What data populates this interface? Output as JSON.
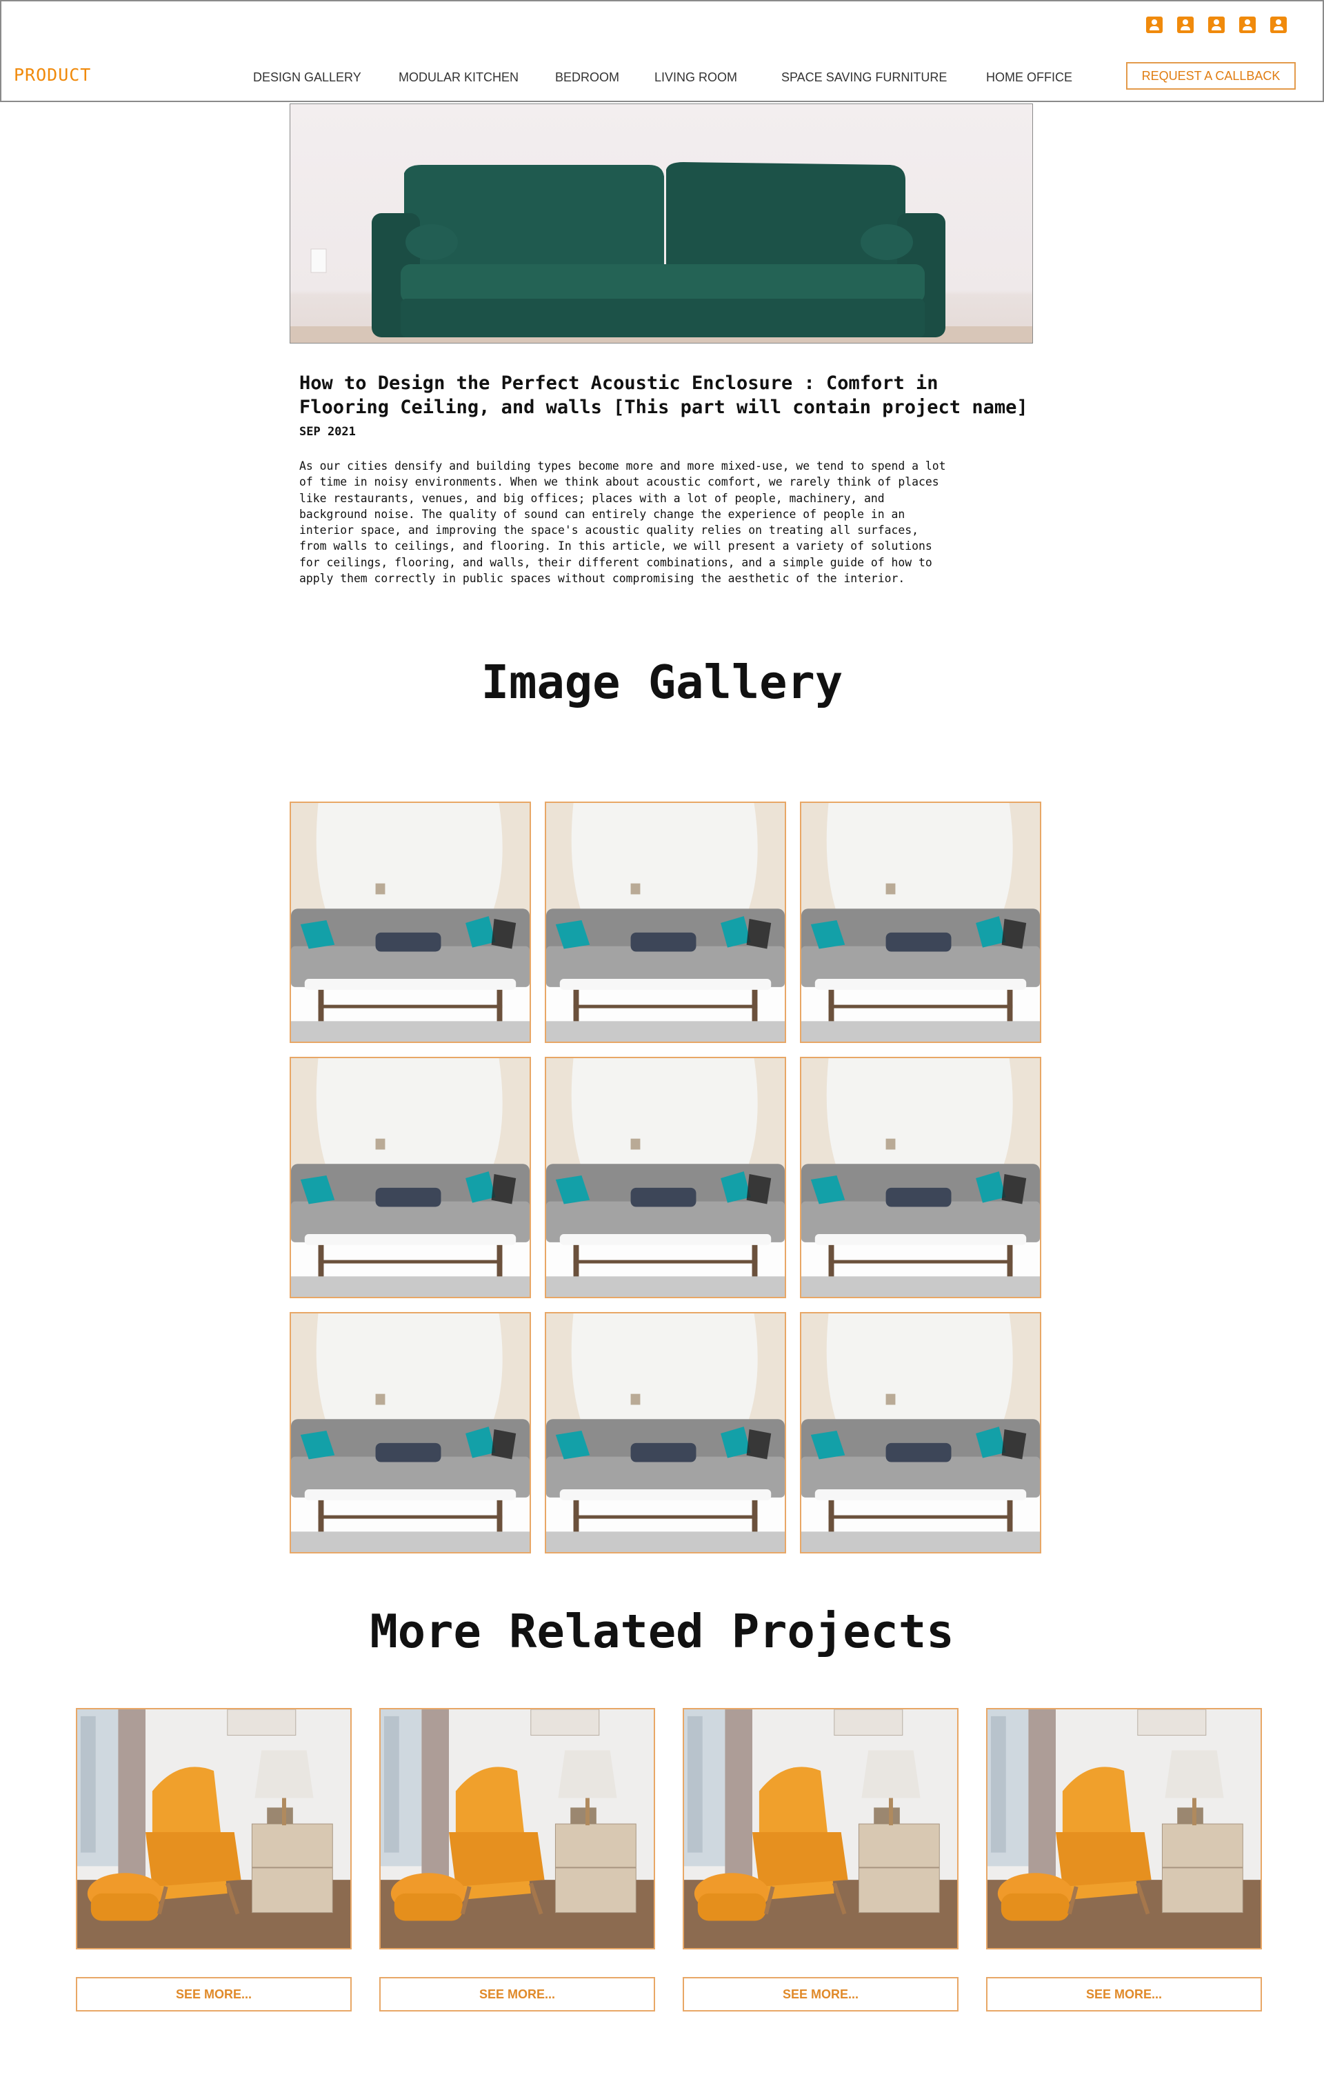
{
  "header": {
    "icons": [
      "user-icon",
      "user-icon",
      "user-icon",
      "user-icon",
      "user-icon"
    ],
    "accent_color": "#f08a0c"
  },
  "nav": {
    "brand": "PRODUCT",
    "links": [
      "DESIGN GALLERY",
      "MODULAR KITCHEN",
      "BEDROOM",
      "LIVING ROOM",
      "SPACE SAVING FURNITURE",
      "HOME OFFICE"
    ],
    "cta": "REQUEST A CALLBACK"
  },
  "article": {
    "hero_image": "green velvet sofa",
    "title": "How to Design the Perfect Acoustic Enclosure : Comfort in Flooring Ceiling, and walls [This part will contain project name]",
    "date": "SEP 2021",
    "body": "As our cities densify and building types become more and more mixed-use, we tend to spend a lot\nof time in noisy environments. When we think about acoustic comfort, we rarely think of places\nlike restaurants, venues, and big offices; places with a lot of people, machinery, and\nbackground noise. The quality of sound can entirely change the experience of people in an\ninterior space, and improving the space's acoustic quality relies on treating all surfaces,\nfrom walls to ceilings, and flooring. In this article, we will present a variety of solutions\nfor ceilings, flooring, and walls, their different combinations, and a simple guide of how to\napply them correctly in public spaces without compromising the aesthetic of the interior."
  },
  "gallery": {
    "title": "Image Gallery",
    "image_count": 9,
    "image": "grey tufted sofa with teal cushions and coffee table"
  },
  "related": {
    "title": "More Related Projects",
    "items": [
      {
        "image": "yellow armchair with ottoman and side table",
        "button": "SEE MORE..."
      },
      {
        "image": "yellow armchair with ottoman and side table",
        "button": "SEE MORE..."
      },
      {
        "image": "yellow armchair with ottoman and side table",
        "button": "SEE MORE..."
      },
      {
        "image": "yellow armchair with ottoman and side table",
        "button": "SEE MORE..."
      }
    ]
  }
}
